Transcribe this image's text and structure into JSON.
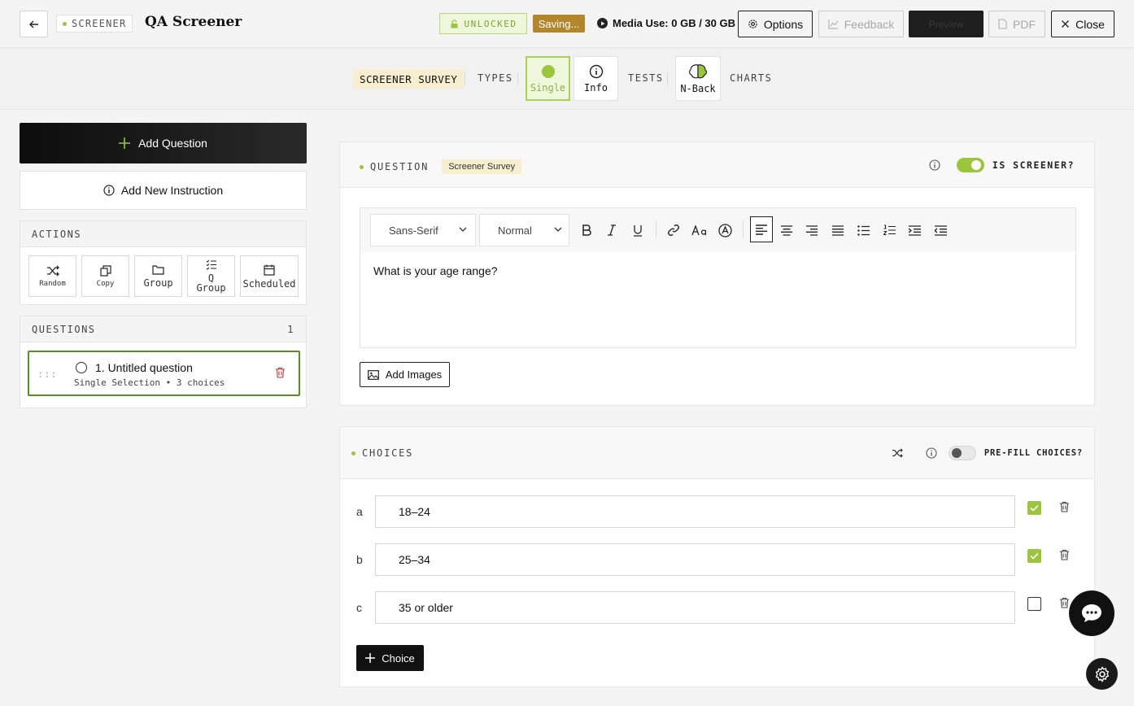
{
  "header": {
    "brand": "SCREENER",
    "title": "QA Screener",
    "unlocked": "UNLOCKED",
    "saving": "Saving...",
    "media_use": "Media Use: 0 GB / 30 GB",
    "options": "Options",
    "feedback": "Feedback",
    "preview": "Preview",
    "pdf": "PDF",
    "close": "Close"
  },
  "nav": {
    "survey": "SCREENER SURVEY",
    "types": "TYPES",
    "single": "Single",
    "info": "Info",
    "tests": "TESTS",
    "nback": "N-Back",
    "charts": "CHARTS"
  },
  "sidebar": {
    "add_question": "Add Question",
    "add_instruction": "Add New Instruction",
    "actions_title": "ACTIONS",
    "actions": [
      {
        "label": "Random",
        "icon": "shuffle-icon"
      },
      {
        "label": "Copy",
        "icon": "copy-icon"
      },
      {
        "label": "Group",
        "icon": "folder-icon"
      },
      {
        "label": "Q\nGroup",
        "icon": "checklist-icon"
      },
      {
        "label": "Scheduled",
        "icon": "calendar-icon"
      }
    ],
    "questions_title": "QUESTIONS",
    "questions_count": "1",
    "questions": [
      {
        "title": "1. Untitled question",
        "subtitle": "Single Selection • 3 choices"
      }
    ]
  },
  "question_card": {
    "label": "QUESTION",
    "tag": "Screener Survey",
    "is_screener_label": "IS SCREENER?",
    "is_screener": true,
    "font_family": "Sans-Serif",
    "font_size": "Normal",
    "body_text": "What is your age range?",
    "add_images": "Add Images"
  },
  "choices_card": {
    "label": "CHOICES",
    "prefill_label": "PRE-FILL CHOICES?",
    "prefill": false,
    "choices": [
      {
        "letter": "a",
        "text": "18–24",
        "checked": true
      },
      {
        "letter": "b",
        "text": "25–34",
        "checked": true
      },
      {
        "letter": "c",
        "text": "35 or older",
        "checked": false
      }
    ],
    "add_choice": "Choice"
  },
  "colors": {
    "accent_green": "#9bc53d",
    "selected_border": "#5b8f22",
    "saving_bg": "#b4862c",
    "tag_bg": "#f7edcf"
  }
}
